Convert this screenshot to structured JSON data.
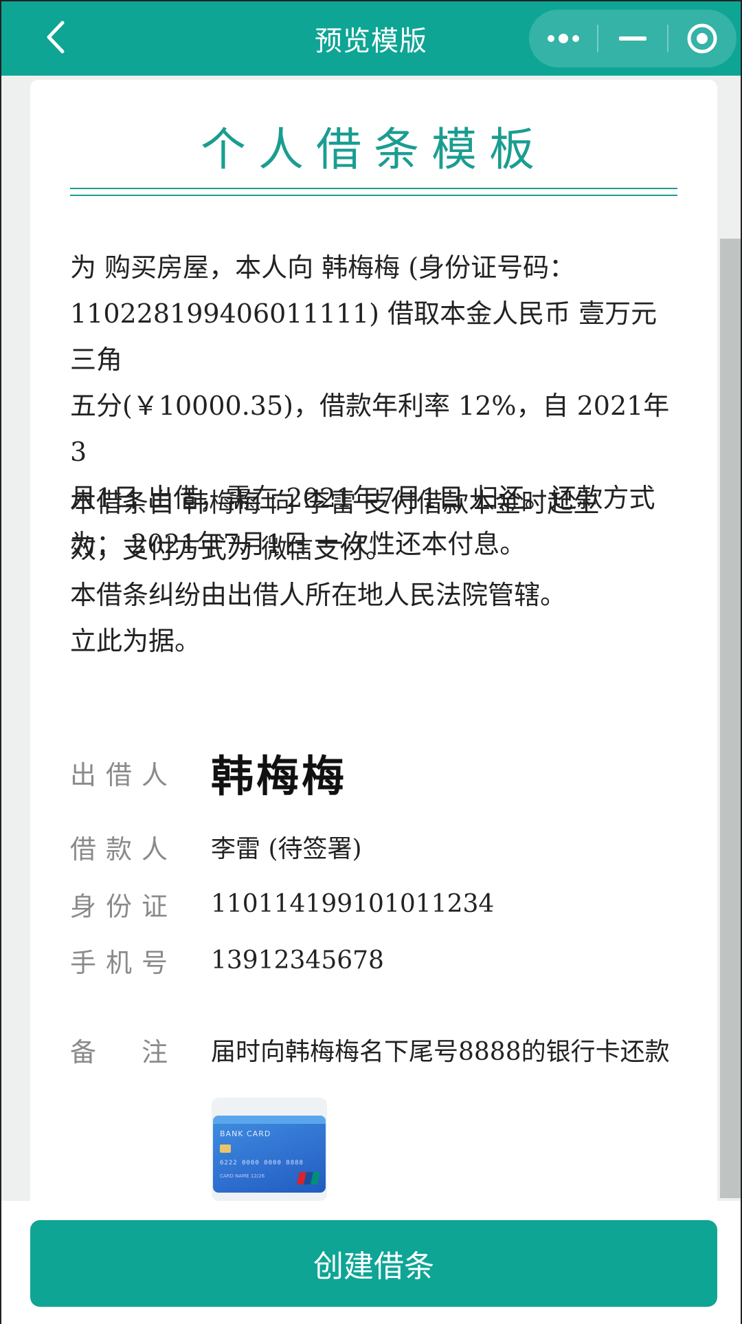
{
  "nav": {
    "title": "预览模版",
    "back_icon": "chevron-left-icon",
    "more_icon": "more-dots-icon",
    "minimize_icon": "minimize-icon",
    "close_icon": "target-circle-icon"
  },
  "document": {
    "title": "个人借条模板",
    "paragraph1_lines": [
      "为 购买房屋，本人向 韩梅梅 (身份证号码：",
      "110228199406011111) 借取本金人民币 壹万元三角",
      "五分(￥10000.35)，借款年利率 12%，自 2021年3",
      "月1日 出借，需在 2021年7月1日 归还。还款方式",
      "为：  2021年7月1日 一次性还本付息。"
    ],
    "paragraph2_lines": [
      "本借条自 韩梅梅 向 李雷 支付借款本金时起生",
      "效，支付方式为 微信支付。",
      "本借条纠纷由出借人所在地人民法院管辖。",
      "立此为据。"
    ]
  },
  "fields": {
    "lender_label": "出借人",
    "lender_signature": "韩梅梅",
    "borrower_label": "借款人",
    "borrower_value": "李雷 (待签署)",
    "id_label": "身份证",
    "id_value": "110114199101011234",
    "phone_label": "手机号",
    "phone_value": "13912345678",
    "remark_label": "备  注",
    "remark_value": "届时向韩梅梅名下尾号8888的银行卡还款"
  },
  "bank_card": {
    "label": "BANK CARD",
    "number": "6222 0000 0000 8888",
    "name_text": "CARD NAME    12/26"
  },
  "footer": {
    "create_button": "创建借条"
  },
  "colors": {
    "accent": "#0ea595",
    "title_green": "#1a9d91"
  }
}
